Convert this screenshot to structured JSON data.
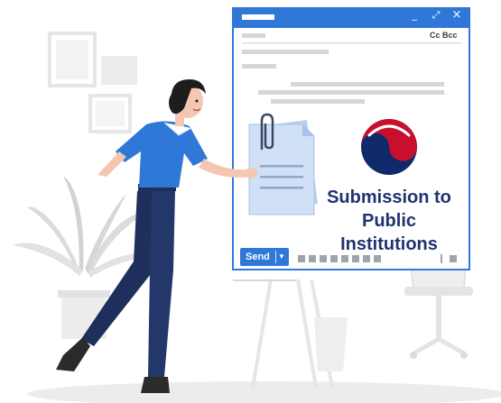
{
  "composer": {
    "cc_bcc_label": "Cc Bcc",
    "send_label": "Send",
    "minimize_glyph": "_",
    "maximize_glyph": "⤢",
    "close_glyph": "×",
    "send_dropdown_glyph": "▼"
  },
  "caption": {
    "line1": "Submission to",
    "line2": "Public",
    "line3": "Institutions"
  },
  "icons": {
    "emblem": "korea-government-emblem-icon",
    "paperclip": "paperclip-icon",
    "document": "document-icon"
  },
  "colors": {
    "window_border": "#2f78d8",
    "title_bar": "#2f78d8",
    "caption_text": "#1f3470",
    "shirt": "#2f78d8",
    "pants": "#1f2f5c",
    "document": "#cfe0f7",
    "emblem_red": "#c8102e",
    "emblem_blue": "#0f2a6b"
  }
}
